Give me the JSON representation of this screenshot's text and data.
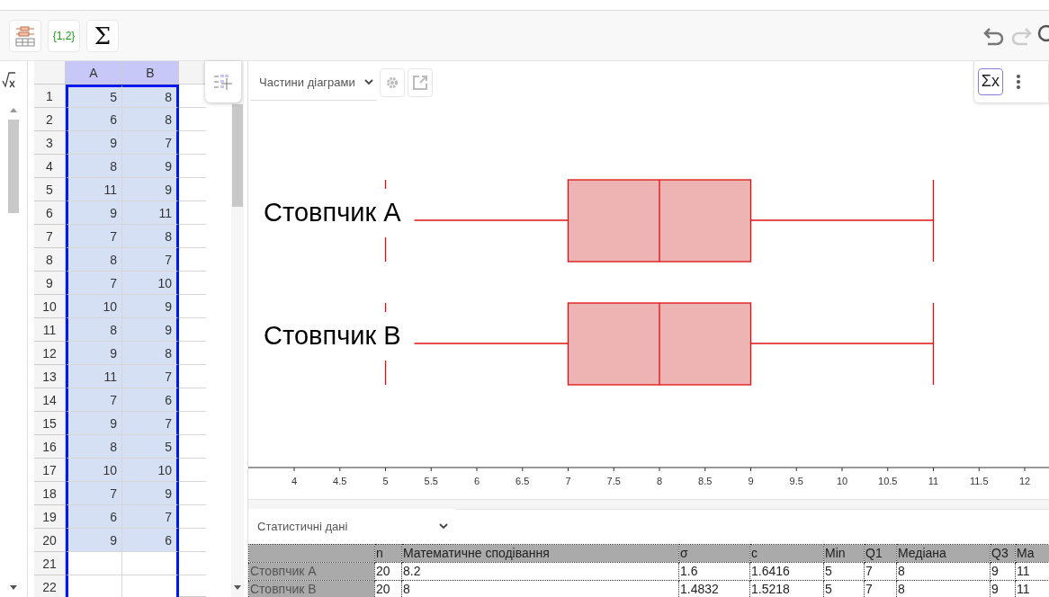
{
  "toolbar": {
    "tools": [
      {
        "kind": "boxplot-tool"
      },
      {
        "kind": "text",
        "label": "{1,2}"
      },
      {
        "kind": "text",
        "label": "Σ"
      }
    ],
    "undo": {
      "disabled": false
    },
    "redo": {
      "disabled": true
    }
  },
  "spreadsheet": {
    "columns": [
      {
        "label": "A",
        "selected": true
      },
      {
        "label": "B",
        "selected": true
      }
    ],
    "rows": [
      {
        "number": "1",
        "cells": [
          "5",
          "8"
        ],
        "selected": true
      },
      {
        "number": "2",
        "cells": [
          "6",
          "8"
        ],
        "selected": true
      },
      {
        "number": "3",
        "cells": [
          "9",
          "7"
        ],
        "selected": true
      },
      {
        "number": "4",
        "cells": [
          "8",
          "9"
        ],
        "selected": true
      },
      {
        "number": "5",
        "cells": [
          "11",
          "9"
        ],
        "selected": true
      },
      {
        "number": "6",
        "cells": [
          "9",
          "11"
        ],
        "selected": true
      },
      {
        "number": "7",
        "cells": [
          "7",
          "8"
        ],
        "selected": true
      },
      {
        "number": "8",
        "cells": [
          "8",
          "7"
        ],
        "selected": true
      },
      {
        "number": "9",
        "cells": [
          "7",
          "10"
        ],
        "selected": true
      },
      {
        "number": "10",
        "cells": [
          "10",
          "9"
        ],
        "selected": true
      },
      {
        "number": "11",
        "cells": [
          "8",
          "9"
        ],
        "selected": true
      },
      {
        "number": "12",
        "cells": [
          "9",
          "8"
        ],
        "selected": true
      },
      {
        "number": "13",
        "cells": [
          "11",
          "7"
        ],
        "selected": true
      },
      {
        "number": "14",
        "cells": [
          "7",
          "6"
        ],
        "selected": true
      },
      {
        "number": "15",
        "cells": [
          "9",
          "7"
        ],
        "selected": true
      },
      {
        "number": "16",
        "cells": [
          "8",
          "5"
        ],
        "selected": true
      },
      {
        "number": "17",
        "cells": [
          "10",
          "10"
        ],
        "selected": true
      },
      {
        "number": "18",
        "cells": [
          "7",
          "9"
        ],
        "selected": true
      },
      {
        "number": "19",
        "cells": [
          "6",
          "7"
        ],
        "selected": true
      },
      {
        "number": "20",
        "cells": [
          "9",
          "6"
        ],
        "selected": true
      },
      {
        "number": "21",
        "cells": [
          "",
          ""
        ],
        "selected": false
      },
      {
        "number": "22",
        "cells": [
          "",
          ""
        ],
        "selected": false
      }
    ]
  },
  "chart_panel": {
    "dropdown": "Частини діаграми",
    "stats_toggle": {
      "label": "Σx",
      "selected": true
    },
    "box_labels": [
      "Стовпчик А",
      "Стовпчик В"
    ],
    "axis_ticks": [
      "4",
      "4.5",
      "5",
      "5.5",
      "6",
      "6.5",
      "7",
      "7.5",
      "8",
      "8.5",
      "9",
      "9.5",
      "10",
      "10.5",
      "11",
      "11.5",
      "12"
    ]
  },
  "statistics": {
    "dropdown": "Статистичні дані",
    "columns": [
      "n",
      "Математичне сподівання",
      "σ",
      "с",
      "Min",
      "Q1",
      "Медіана",
      "Q3",
      "Ma"
    ],
    "rows": [
      {
        "label": "Стовпчик А",
        "values": [
          "20",
          "8.2",
          "1.6",
          "1.6416",
          "5",
          "7",
          "8",
          "9",
          "11"
        ]
      },
      {
        "label": "Стовпчик В",
        "values": [
          "20",
          "8",
          "1.4832",
          "1.5218",
          "5",
          "7",
          "8",
          "9",
          "11"
        ]
      }
    ]
  }
}
